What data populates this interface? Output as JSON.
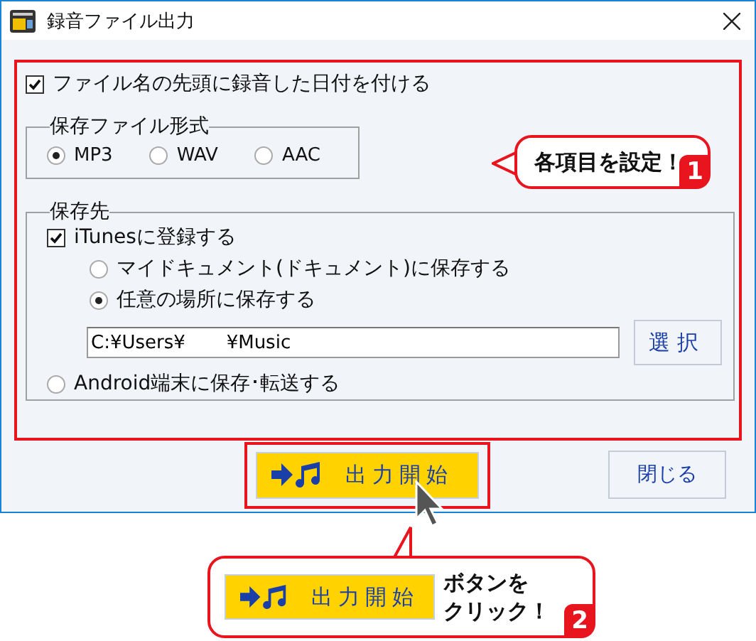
{
  "window": {
    "title": "録音ファイル出力"
  },
  "date_prefix": {
    "label": "ファイル名の先頭に録音した日付を付ける",
    "checked": true
  },
  "format_group": {
    "title": "保存ファイル形式",
    "options": [
      {
        "label": "MP3",
        "selected": true
      },
      {
        "label": "WAV",
        "selected": false
      },
      {
        "label": "AAC",
        "selected": false
      }
    ]
  },
  "destination_group": {
    "title": "保存先",
    "itunes": {
      "label": "iTunesに登録する",
      "checked": true
    },
    "itunes_options": [
      {
        "label": "マイドキュメント(ドキュメント)に保存する",
        "selected": false
      },
      {
        "label": "任意の場所に保存する",
        "selected": true
      }
    ],
    "path_field": {
      "value": "C:¥Users¥       ¥Music"
    },
    "browse_button": "選択",
    "android": {
      "label": "Android端末に保存･転送する",
      "selected": false
    }
  },
  "buttons": {
    "start": "出力開始",
    "close": "閉じる"
  },
  "callouts": [
    {
      "number": "1",
      "lines": [
        "各項目を設定！"
      ]
    },
    {
      "number": "2",
      "sample_button": "出力開始",
      "lines": [
        "ボタンを",
        "クリック！"
      ]
    }
  ]
}
